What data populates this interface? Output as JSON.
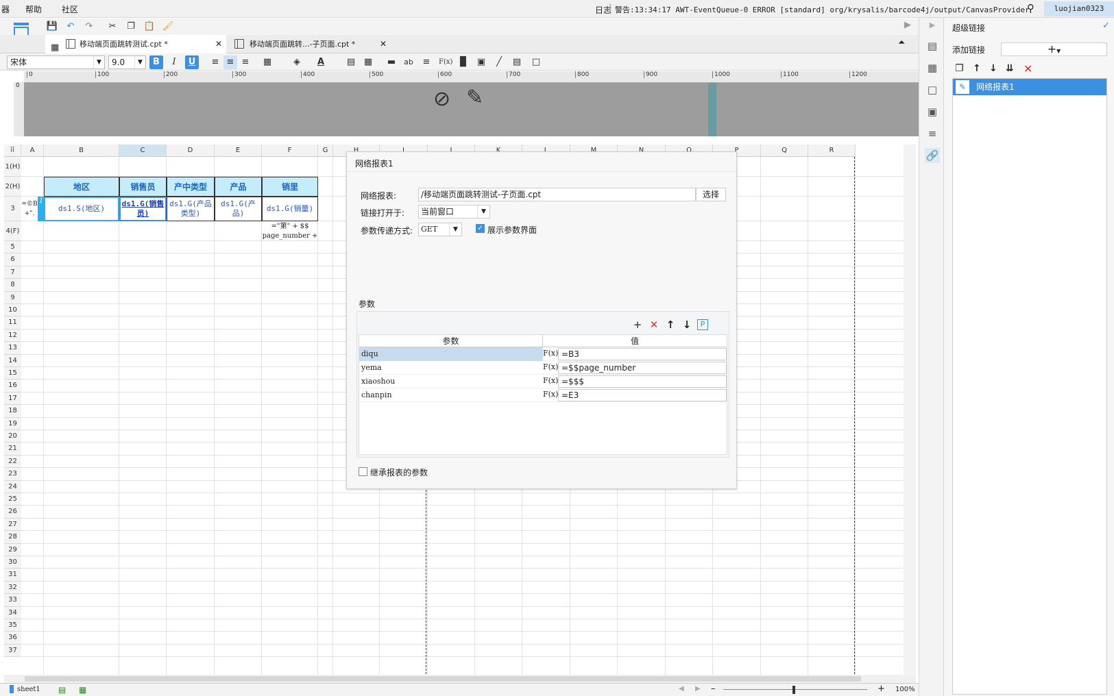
{
  "menu": {
    "left_cut": "器",
    "help": "帮助",
    "community": "社区"
  },
  "header": {
    "log_label": "日志",
    "log_message": "警告:13:34:17 AWT-EventQueue-0 ERROR [standard] org/krysalis/barcode4j/output/CanvasProvider",
    "user": "luojian0323"
  },
  "tabs": [
    {
      "label": "移动端页面跳转测试.cpt *",
      "active": true
    },
    {
      "label": "移动端页面跳转...-子页面.cpt *",
      "active": false
    }
  ],
  "format": {
    "font": "宋体",
    "size": "9.0",
    "bold": "B",
    "italic": "I",
    "underline": "U",
    "abc": "ab",
    "fx": "F(x)"
  },
  "ruler_ticks": [
    "0",
    "100",
    "200",
    "300",
    "400",
    "500",
    "600",
    "700",
    "800",
    "900",
    "1000",
    "1100",
    "1200"
  ],
  "columns": [
    "A",
    "B",
    "C",
    "D",
    "E",
    "F",
    "G",
    "H",
    "I",
    "J",
    "K",
    "L",
    "M",
    "N",
    "O",
    "P",
    "Q",
    "R"
  ],
  "rows": [
    "1(H)",
    "2(H)",
    "3",
    "4(F)",
    "5",
    "6",
    "7",
    "8",
    "9",
    "10",
    "11",
    "12",
    "13",
    "14",
    "15",
    "16",
    "17",
    "18",
    "19",
    "20",
    "21",
    "22",
    "23",
    "24",
    "25",
    "26",
    "27",
    "28",
    "29",
    "30",
    "31",
    "32",
    "33",
    "34",
    "35",
    "36",
    "37"
  ],
  "cells": {
    "header_row": [
      "地区",
      "销售员",
      "产中类型",
      "产品",
      "销里"
    ],
    "data_row": [
      "ds1.S(地区)",
      "ds1.G(销售员)",
      "ds1.G(产品类型)",
      "ds1.G(产品)",
      "ds1.G(销量)"
    ],
    "a3": "=©B +\".",
    "a3_badge": "1",
    "f4": "=\"第\" + $$ page_number +"
  },
  "dialog": {
    "title": "网络报表1",
    "report_label": "网络报表:",
    "report_value": "/移动端页面跳转测试-子页面.cpt",
    "choose": "选择",
    "open_in_label": "链接打开于:",
    "open_in_value": "当前窗口",
    "method_label": "参数传递方式:",
    "method_value": "GET",
    "show_params": "展示参数界面",
    "params_group": "参数",
    "col_param": "参数",
    "col_value": "值",
    "p_button": "P",
    "params": [
      {
        "name": "diqu",
        "fx": "F(x)",
        "value": "=B3"
      },
      {
        "name": "yema",
        "fx": "F(x)",
        "value": "=$$page_number"
      },
      {
        "name": "xiaoshou",
        "fx": "F(x)",
        "value": "=$$$"
      },
      {
        "name": "chanpin",
        "fx": "F(x)",
        "value": "=E3"
      }
    ],
    "inherit": "继承报表的参数"
  },
  "right_panel": {
    "title": "超级链接",
    "add_label": "添加链接",
    "add_symbol": "+",
    "item": "网络报表1"
  },
  "status": {
    "sheet": "sheet1",
    "zoom": "100%"
  },
  "colors": {
    "accent": "#3d8fe0",
    "header_fill": "#c4ecfb",
    "header_text": "#1a66c6",
    "danger": "#e03030"
  }
}
